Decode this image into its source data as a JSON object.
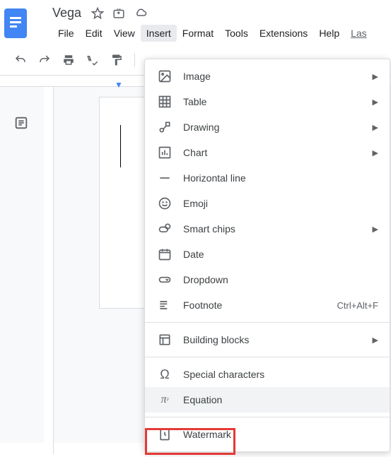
{
  "doc": {
    "title": "Vega"
  },
  "menus": {
    "file": "File",
    "edit": "Edit",
    "view": "View",
    "insert": "Insert",
    "format": "Format",
    "tools": "Tools",
    "extensions": "Extensions",
    "help": "Help",
    "last": "Las"
  },
  "insert_menu": {
    "image": "Image",
    "table": "Table",
    "drawing": "Drawing",
    "chart": "Chart",
    "hline": "Horizontal line",
    "emoji": "Emoji",
    "smart_chips": "Smart chips",
    "date": "Date",
    "dropdown": "Dropdown",
    "footnote": "Footnote",
    "footnote_shortcut": "Ctrl+Alt+F",
    "building_blocks": "Building blocks",
    "special_chars": "Special characters",
    "equation": "Equation",
    "watermark": "Watermark"
  }
}
